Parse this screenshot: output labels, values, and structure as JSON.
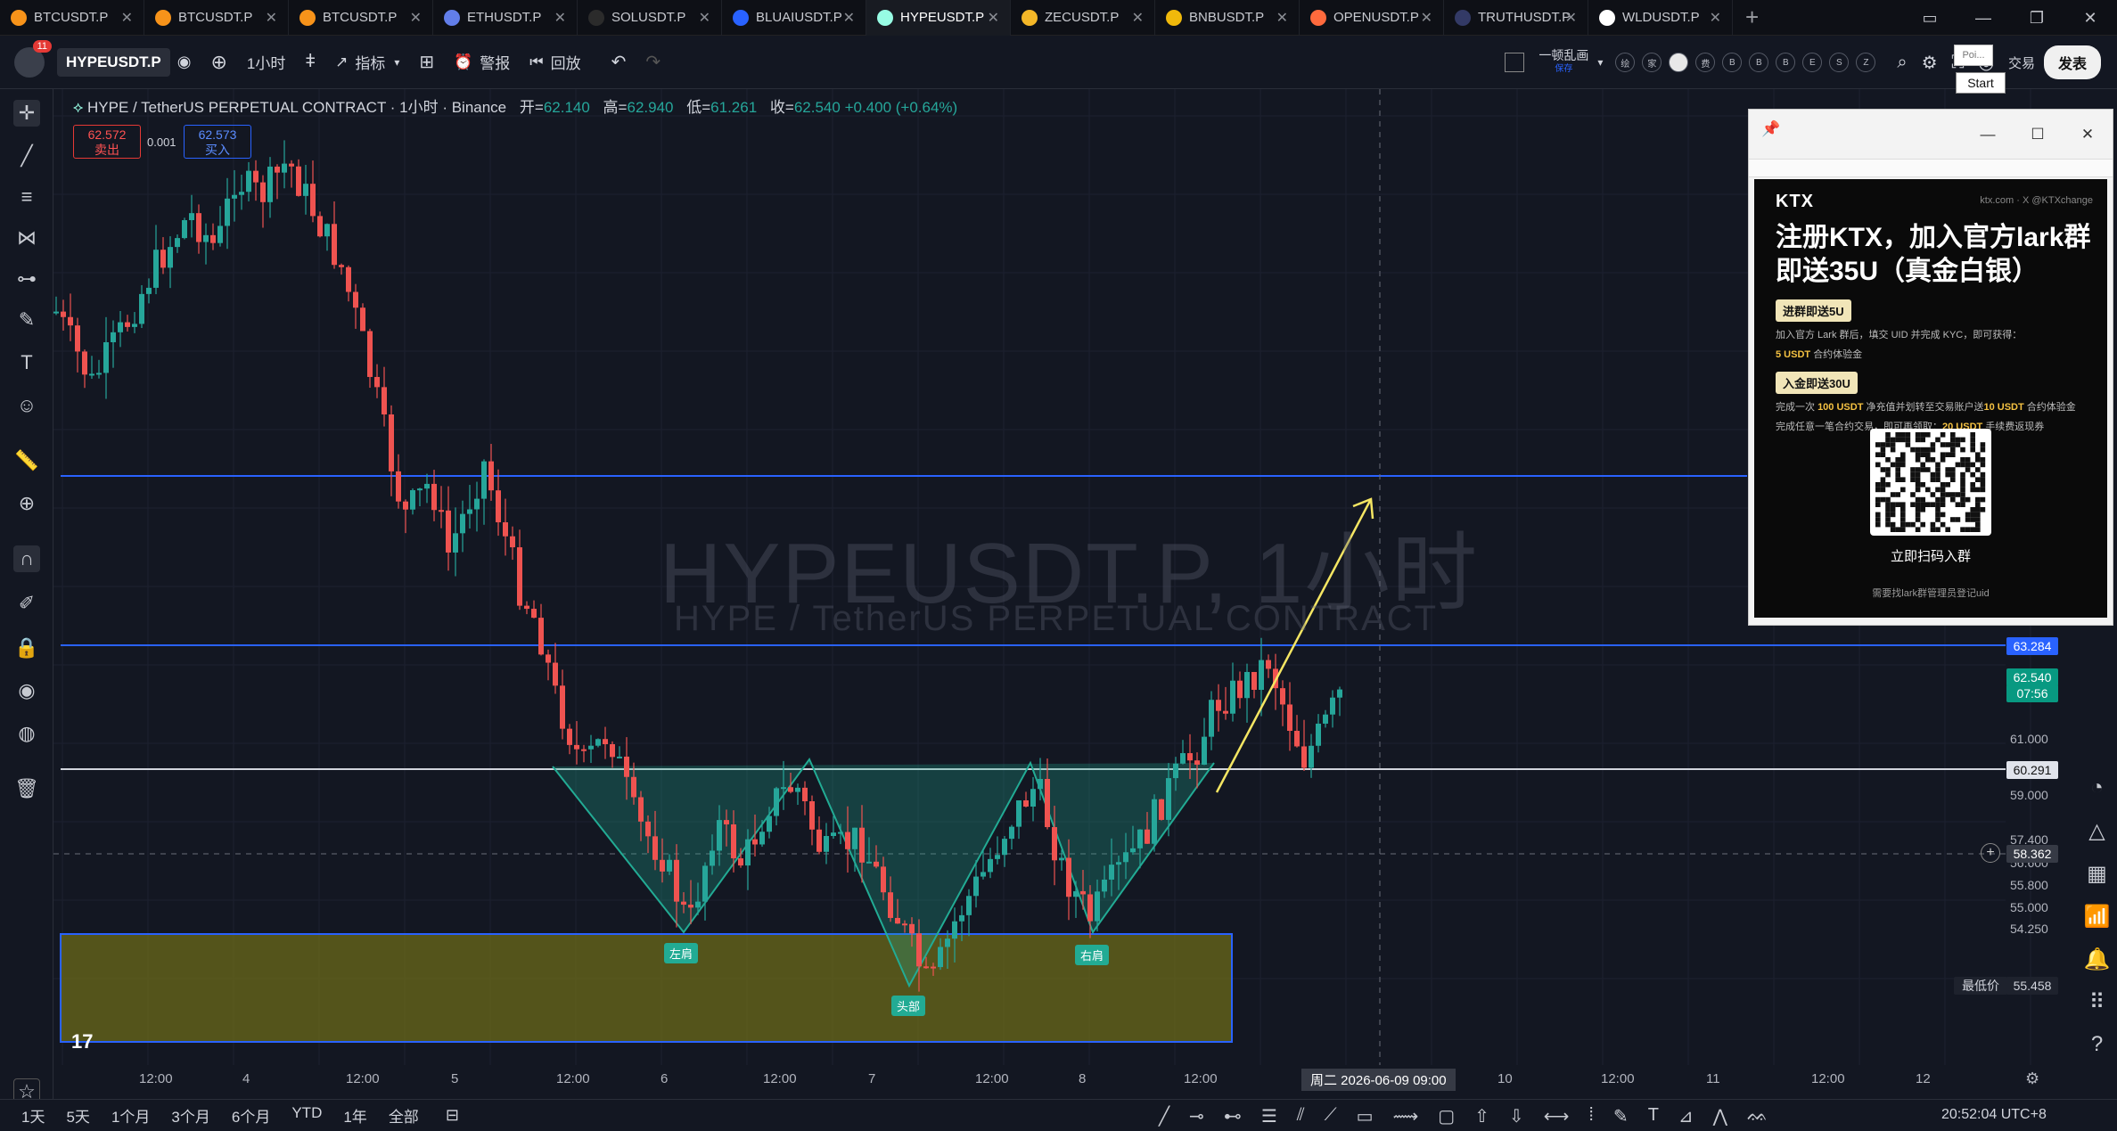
{
  "browser_tabs": [
    {
      "label": "BTCUSDT.P",
      "icon": "bitcoin-icon",
      "color": "#f7931a"
    },
    {
      "label": "BTCUSDT.P",
      "icon": "bitcoin-icon",
      "color": "#f7931a"
    },
    {
      "label": "BTCUSDT.P",
      "icon": "bitcoin-icon",
      "color": "#f7931a"
    },
    {
      "label": "ETHUSDT.P",
      "icon": "ethereum-icon",
      "color": "#627eea"
    },
    {
      "label": "SOLUSDT.P",
      "icon": "solana-icon",
      "color": "#2b2b2b"
    },
    {
      "label": "BLUAIUSDT.P",
      "icon": "blue-coin-icon",
      "color": "#2962ff"
    },
    {
      "label": "HYPEUSDT.P",
      "icon": "hype-icon",
      "color": "#97fce4",
      "active": true
    },
    {
      "label": "ZECUSDT.P",
      "icon": "zcash-icon",
      "color": "#f4b728"
    },
    {
      "label": "BNBUSDT.P",
      "icon": "bnb-icon",
      "color": "#f0b90b"
    },
    {
      "label": "OPENUSDT.P",
      "icon": "open-icon",
      "color": "#ff6a3d"
    },
    {
      "label": "TRUTHUSDT.P",
      "icon": "truth-icon",
      "color": "#333a66"
    },
    {
      "label": "WLDUSDT.P",
      "icon": "worldcoin-icon",
      "color": "#ffffff"
    }
  ],
  "toolbar": {
    "notif_count": "11",
    "symbol": "HYPEUSDT.P",
    "interval": "1小时",
    "indicators": "指标",
    "alert": "警报",
    "replay": "回放",
    "layout_name": "一顿乱画",
    "layout_sub": "保存",
    "publish": "发表",
    "trade": "交易",
    "circle_buttons": [
      "绘",
      "家",
      "",
      "费",
      "B",
      "B",
      "B",
      "E",
      "S",
      "Z"
    ]
  },
  "chart": {
    "title": "HYPE / TetherUS PERPETUAL CONTRACT · 1小时 · Binance",
    "ohlc": {
      "open_label": "开=",
      "open": "62.140",
      "high_label": "高=",
      "high": "62.940",
      "low_label": "低=",
      "low": "61.261",
      "close_label": "收=",
      "close": "62.540",
      "change": "+0.400 (+0.64%)"
    },
    "sell_price": "62.572",
    "sell_label": "卖出",
    "buy_price": "62.573",
    "buy_label": "买入",
    "spread": "0.001",
    "watermark": "HYPEUSDT.P, 1小时",
    "watermark_sub": "HYPE / TetherUS PERPETUAL CONTRACT",
    "price_ticks": [
      "61.000",
      "59.000",
      "57.400",
      "56.600",
      "55.800",
      "55.000",
      "54.250"
    ],
    "price_tags": {
      "resistance": "63.284",
      "last": "62.540",
      "countdown": "07:56",
      "neckline": "60.291",
      "crosshair": "58.362",
      "low_label": "最低价",
      "low": "55.458"
    },
    "time_ticks": [
      "12:00",
      "4",
      "12:00",
      "5",
      "12:00",
      "6",
      "12:00",
      "7",
      "12:00",
      "8",
      "12:00",
      "10",
      "12:00",
      "11",
      "12:00",
      "12"
    ],
    "crosshair_time": "周二 2026-06-09  09:00",
    "pattern_labels": {
      "left_shoulder": "左肩",
      "head": "头部",
      "right_shoulder": "右肩"
    }
  },
  "popup": {
    "logo": "KTX",
    "site": "ktx.com  ·  X @KTXchange",
    "headline1": "注册KTX，加入官方lark群",
    "headline2": "即送35U（真金白银）",
    "pill1": "进群即送5U",
    "text1": "加入官方 Lark 群后，填交 UID 并完成 KYC，即可获得：",
    "text1b": "5 USDT",
    "text1c": "合约体验金",
    "pill2": "入金即送30U",
    "text2a": "完成一次",
    "text2b": "100 USDT",
    "text2c": "净充值并划转至交易账户送",
    "text2d": "10 USDT",
    "text2e": "合约体验金",
    "text3a": "完成任意一笔合约交易，即可再领取：",
    "text3b": "20 USDT",
    "text3c": "手续费返现券",
    "scan": "立即扫码入群",
    "foot": "需要找lark群管理员登记uid"
  },
  "tooltips": {
    "poi": "Poi...",
    "start": "Start"
  },
  "bottom": {
    "ranges": [
      "1天",
      "5天",
      "1个月",
      "3个月",
      "6个月",
      "YTD",
      "1年",
      "全部"
    ],
    "clock": "20:52:04 UTC+8"
  },
  "colors": {
    "up": "#26a69a",
    "down": "#ef5350",
    "bg": "#131722",
    "hline": "#2962ff",
    "neckline": "#d1d4dc",
    "arrow": "#f5e663",
    "zone": "#6b6a1a",
    "pattern": "#22ab94"
  }
}
